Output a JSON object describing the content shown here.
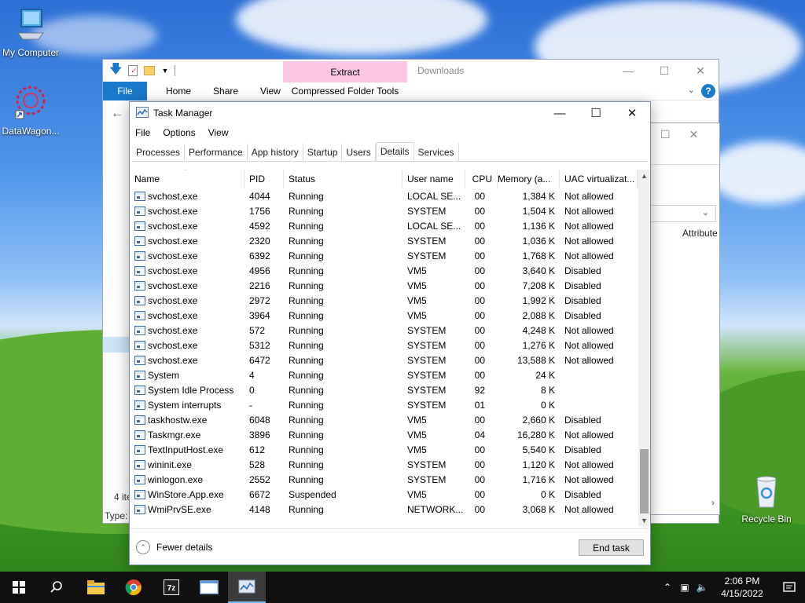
{
  "desktop": {
    "icons": [
      {
        "label": "My Computer",
        "icon": "computer-icon"
      },
      {
        "label": "DataWagon...",
        "icon": "datawagon-shortcut-icon"
      },
      {
        "label": "Recycle Bin",
        "icon": "recycle-bin-icon"
      }
    ]
  },
  "explorer": {
    "contextual_tab": "Extract",
    "title": "Downloads",
    "ribbon_tabs": [
      "File",
      "Home",
      "Share",
      "View"
    ],
    "contextual_ribbon": "Compressed Folder Tools",
    "status_items": "4 ite",
    "status_type": "Type:"
  },
  "window2": {
    "column_header": "Attribute"
  },
  "taskmanager": {
    "title": "Task Manager",
    "menu": [
      "File",
      "Options",
      "View"
    ],
    "tabs": [
      "Processes",
      "Performance",
      "App history",
      "Startup",
      "Users",
      "Details",
      "Services"
    ],
    "active_tab": "Details",
    "columns": [
      "Name",
      "PID",
      "Status",
      "User name",
      "CPU",
      "Memory (a...",
      "UAC virtualizat..."
    ],
    "rows": [
      {
        "name": "svchost.exe",
        "pid": "4044",
        "status": "Running",
        "user": "LOCAL SE...",
        "cpu": "00",
        "mem": "1,384 K",
        "uac": "Not allowed"
      },
      {
        "name": "svchost.exe",
        "pid": "1756",
        "status": "Running",
        "user": "SYSTEM",
        "cpu": "00",
        "mem": "1,504 K",
        "uac": "Not allowed"
      },
      {
        "name": "svchost.exe",
        "pid": "4592",
        "status": "Running",
        "user": "LOCAL SE...",
        "cpu": "00",
        "mem": "1,136 K",
        "uac": "Not allowed"
      },
      {
        "name": "svchost.exe",
        "pid": "2320",
        "status": "Running",
        "user": "SYSTEM",
        "cpu": "00",
        "mem": "1,036 K",
        "uac": "Not allowed"
      },
      {
        "name": "svchost.exe",
        "pid": "6392",
        "status": "Running",
        "user": "SYSTEM",
        "cpu": "00",
        "mem": "1,768 K",
        "uac": "Not allowed"
      },
      {
        "name": "svchost.exe",
        "pid": "4956",
        "status": "Running",
        "user": "VM5",
        "cpu": "00",
        "mem": "3,640 K",
        "uac": "Disabled"
      },
      {
        "name": "svchost.exe",
        "pid": "2216",
        "status": "Running",
        "user": "VM5",
        "cpu": "00",
        "mem": "7,208 K",
        "uac": "Disabled"
      },
      {
        "name": "svchost.exe",
        "pid": "2972",
        "status": "Running",
        "user": "VM5",
        "cpu": "00",
        "mem": "1,992 K",
        "uac": "Disabled"
      },
      {
        "name": "svchost.exe",
        "pid": "3964",
        "status": "Running",
        "user": "VM5",
        "cpu": "00",
        "mem": "2,088 K",
        "uac": "Disabled"
      },
      {
        "name": "svchost.exe",
        "pid": "572",
        "status": "Running",
        "user": "SYSTEM",
        "cpu": "00",
        "mem": "4,248 K",
        "uac": "Not allowed"
      },
      {
        "name": "svchost.exe",
        "pid": "5312",
        "status": "Running",
        "user": "SYSTEM",
        "cpu": "00",
        "mem": "1,276 K",
        "uac": "Not allowed"
      },
      {
        "name": "svchost.exe",
        "pid": "6472",
        "status": "Running",
        "user": "SYSTEM",
        "cpu": "00",
        "mem": "13,588 K",
        "uac": "Not allowed"
      },
      {
        "name": "System",
        "pid": "4",
        "status": "Running",
        "user": "SYSTEM",
        "cpu": "00",
        "mem": "24 K",
        "uac": ""
      },
      {
        "name": "System Idle Process",
        "pid": "0",
        "status": "Running",
        "user": "SYSTEM",
        "cpu": "92",
        "mem": "8 K",
        "uac": ""
      },
      {
        "name": "System interrupts",
        "pid": "-",
        "status": "Running",
        "user": "SYSTEM",
        "cpu": "01",
        "mem": "0 K",
        "uac": ""
      },
      {
        "name": "taskhostw.exe",
        "pid": "6048",
        "status": "Running",
        "user": "VM5",
        "cpu": "00",
        "mem": "2,660 K",
        "uac": "Disabled"
      },
      {
        "name": "Taskmgr.exe",
        "pid": "3896",
        "status": "Running",
        "user": "VM5",
        "cpu": "04",
        "mem": "16,280 K",
        "uac": "Not allowed"
      },
      {
        "name": "TextInputHost.exe",
        "pid": "612",
        "status": "Running",
        "user": "VM5",
        "cpu": "00",
        "mem": "5,540 K",
        "uac": "Disabled"
      },
      {
        "name": "wininit.exe",
        "pid": "528",
        "status": "Running",
        "user": "SYSTEM",
        "cpu": "00",
        "mem": "1,120 K",
        "uac": "Not allowed"
      },
      {
        "name": "winlogon.exe",
        "pid": "2552",
        "status": "Running",
        "user": "SYSTEM",
        "cpu": "00",
        "mem": "1,716 K",
        "uac": "Not allowed"
      },
      {
        "name": "WinStore.App.exe",
        "pid": "6672",
        "status": "Suspended",
        "user": "VM5",
        "cpu": "00",
        "mem": "0 K",
        "uac": "Disabled"
      },
      {
        "name": "WmiPrvSE.exe",
        "pid": "4148",
        "status": "Running",
        "user": "NETWORK...",
        "cpu": "00",
        "mem": "3,068 K",
        "uac": "Not allowed"
      }
    ],
    "fewer_details": "Fewer details",
    "end_task": "End task"
  },
  "taskbar": {
    "apps": [
      "file-explorer-icon",
      "chrome-icon",
      "7zip-icon",
      "window-app-icon",
      "task-manager-icon"
    ],
    "time": "2:06 PM",
    "date": "4/15/2022"
  }
}
